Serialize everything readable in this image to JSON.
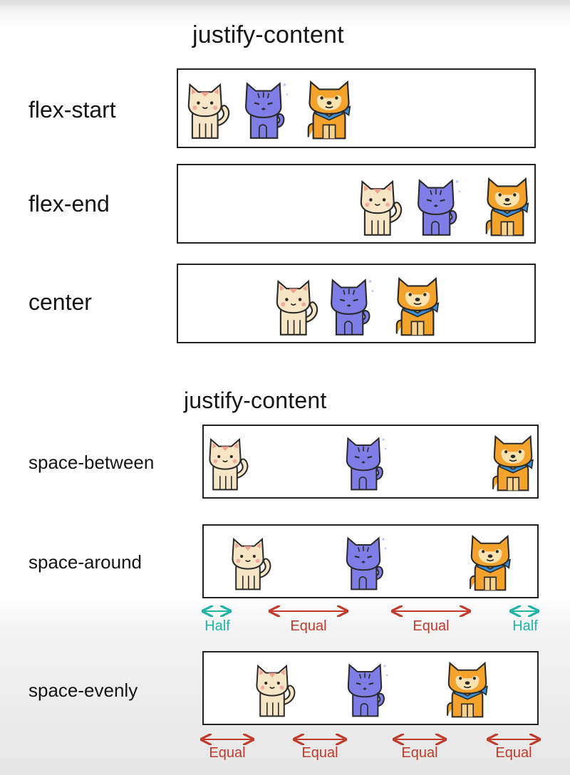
{
  "colors": {
    "teal": "#1fb3a6",
    "red": "#c0392b"
  },
  "headings": {
    "top": "justify-content",
    "bottom": "justify-content"
  },
  "rows": [
    {
      "label": "flex-start",
      "pets": [
        "cream-cat-icon",
        "blue-cat-icon",
        "shiba-dog-icon"
      ]
    },
    {
      "label": "flex-end",
      "pets": [
        "cream-cat-icon",
        "blue-cat-icon",
        "shiba-dog-icon"
      ]
    },
    {
      "label": "center",
      "pets": [
        "cream-cat-icon",
        "blue-cat-icon",
        "shiba-dog-icon"
      ]
    },
    {
      "label": "space-between",
      "pets": [
        "cream-cat-icon",
        "blue-cat-icon",
        "shiba-dog-icon"
      ]
    },
    {
      "label": "space-around",
      "pets": [
        "cream-cat-icon",
        "blue-cat-icon",
        "shiba-dog-icon"
      ]
    },
    {
      "label": "space-evenly",
      "pets": [
        "cream-cat-icon",
        "blue-cat-icon",
        "shiba-dog-icon"
      ]
    }
  ],
  "space_around_annotations": [
    "Half",
    "Equal",
    "Equal",
    "Half"
  ],
  "space_evenly_annotations": [
    "Equal",
    "Equal",
    "Equal",
    "Equal"
  ]
}
